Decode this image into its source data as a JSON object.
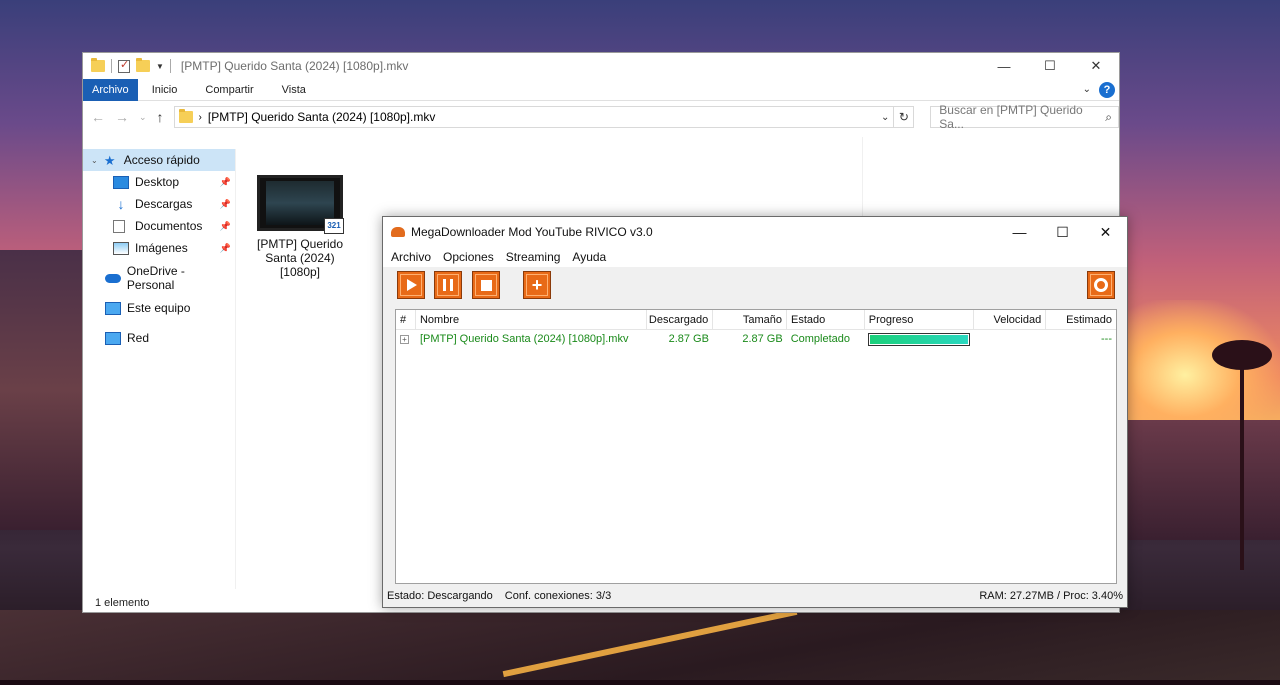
{
  "explorer": {
    "title": "[PMTP] Querido Santa (2024) [1080p].mkv",
    "ribbon_tabs": [
      "Archivo",
      "Inicio",
      "Compartir",
      "Vista"
    ],
    "address_path": "[PMTP] Querido Santa (2024) [1080p].mkv",
    "search_placeholder": "Buscar en [PMTP] Querido Sa...",
    "sidebar": [
      {
        "label": "Acceso rápido",
        "icon": "star-icon"
      },
      {
        "label": "Desktop",
        "icon": "desktop-icon"
      },
      {
        "label": "Descargas",
        "icon": "download-icon"
      },
      {
        "label": "Documentos",
        "icon": "document-icon"
      },
      {
        "label": "Imágenes",
        "icon": "pictures-icon"
      },
      {
        "label": "OneDrive - Personal",
        "icon": "cloud-icon"
      },
      {
        "label": "Este equipo",
        "icon": "computer-icon"
      },
      {
        "label": "Red",
        "icon": "network-icon"
      }
    ],
    "file": {
      "name": "[PMTP] Querido Santa (2024) [1080p]",
      "badge": "321"
    },
    "status": "1 elemento"
  },
  "mega": {
    "title": "MegaDownloader Mod YouTube RIVICO v3.0",
    "menu": [
      "Archivo",
      "Opciones",
      "Streaming",
      "Ayuda"
    ],
    "columns": {
      "num": "#",
      "name": "Nombre",
      "downloaded": "Descargado",
      "size": "Tamaño",
      "state": "Estado",
      "progress": "Progreso",
      "speed": "Velocidad",
      "eta": "Estimado"
    },
    "rows": [
      {
        "name": "[PMTP] Querido Santa (2024) [1080p].mkv",
        "downloaded": "2.87 GB",
        "size": "2.87 GB",
        "state": "Completado",
        "progress": 1.0,
        "speed": "",
        "eta": "---"
      }
    ],
    "status_left": "Estado: Descargando",
    "status_conn": "Conf. conexiones: 3/3",
    "status_right": "RAM: 27.27MB / Proc: 3.40%"
  },
  "colors": {
    "accent_orange": "#e86a17",
    "completed_green": "#1a8a1a",
    "ribbon_blue": "#1a5fb4"
  }
}
